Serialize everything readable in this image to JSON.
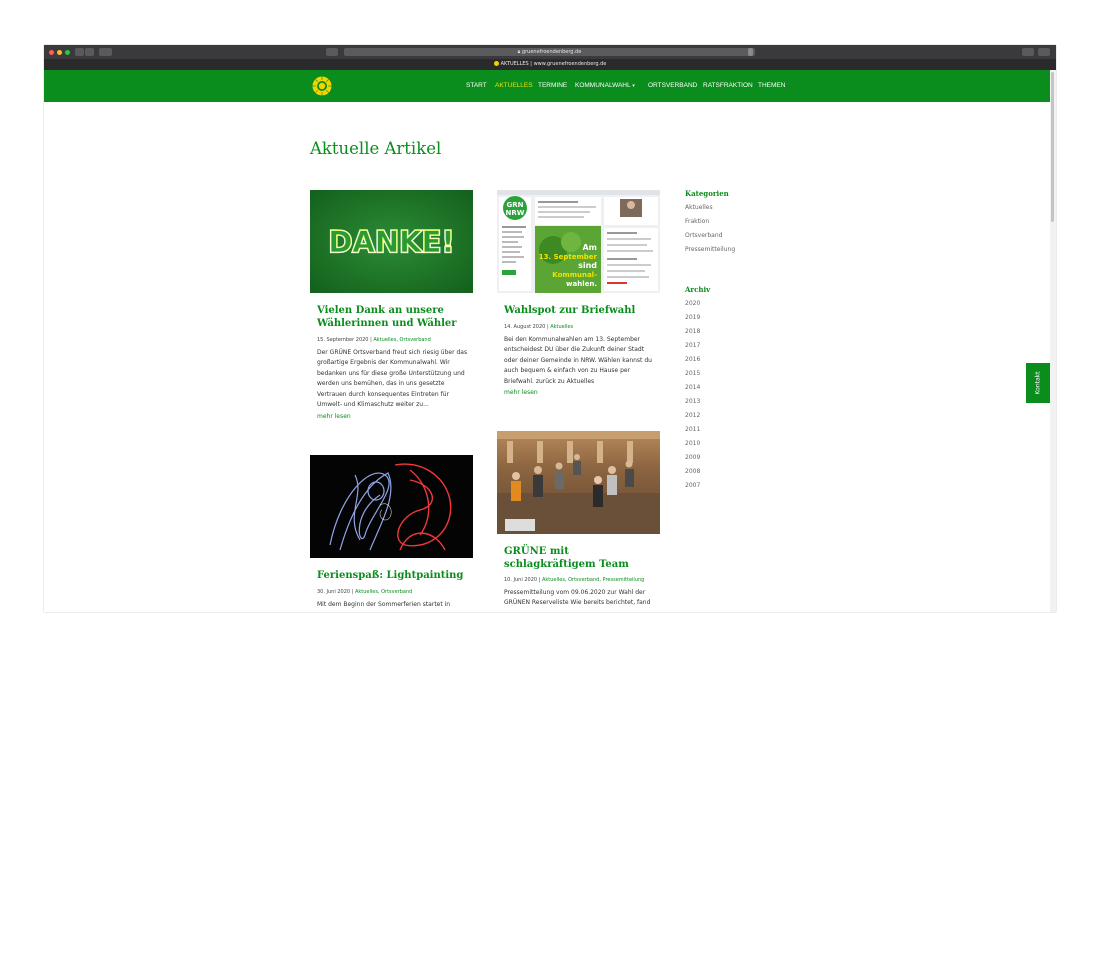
{
  "browser": {
    "url": "gruenefroendenberg.de",
    "tab_title": "AKTUELLES | www.gruenefroendenberg.de"
  },
  "nav": {
    "items": [
      "START",
      "AKTUELLES",
      "TERMINE",
      "KOMMUNALWAHL",
      "ORTSVERBAND",
      "RATSFRAKTION",
      "THEMEN"
    ],
    "active": "AKTUELLES",
    "dropdown_item": "KOMMUNALWAHL"
  },
  "page": {
    "title": "Aktuelle Artikel"
  },
  "posts": [
    {
      "title": "Vielen Dank an unsere Wählerinnen und Wähler",
      "image_text": "DANKE!",
      "date": "15. September 2020",
      "categories": [
        "Aktuelles",
        "Ortsverband"
      ],
      "excerpt": "Der GRÜNE Ortsverband freut sich riesig über das großartige Ergebnis der Kommunalwahl. Wir bedanken uns für diese große Unterstützung und werden uns bemühen, das in uns gesetzte Vertrauen durch konsequentes Eintreten für Umwelt- und Klimaschutz weiter zu...",
      "more": "mehr lesen"
    },
    {
      "title": "Wahlspot zur Briefwahl",
      "image_text": "Am 13. September sind Kommunal-wahlen.",
      "image_badge": "GRN NRW",
      "date": "14. August 2020",
      "categories": [
        "Aktuelles"
      ],
      "excerpt": "Bei den Kommunalwahlen am 13. September entscheidest DU über die Zukunft deiner Stadt oder deiner Gemeinde in NRW. Wählen kannst du auch bequem & einfach von zu Hause per Briefwahl.     zurück zu Aktuelles",
      "more": "mehr lesen"
    },
    {
      "title": "Ferienspaß: Lightpainting",
      "date": "30. Juni 2020",
      "categories": [
        "Aktuelles",
        "Ortsverband"
      ],
      "excerpt": "Mit dem Beginn der Sommerferien startet in"
    },
    {
      "title": "GRÜNE mit schlagkräftigem Team",
      "date": "10. Juni 2020",
      "categories": [
        "Aktuelles",
        "Ortsverband",
        "Pressemitteilung"
      ],
      "excerpt": "Pressemitteilung vom 09.06.2020 zur Wahl der GRÜNEN Reserveliste Wie bereits berichtet, fand"
    }
  ],
  "sidebar": {
    "categories_title": "Kategorien",
    "categories": [
      "Aktuelles",
      "Fraktion",
      "Ortsverband",
      "Pressemitteilung"
    ],
    "archive_title": "Archiv",
    "archive": [
      "2020",
      "2019",
      "2018",
      "2017",
      "2016",
      "2015",
      "2014",
      "2013",
      "2012",
      "2011",
      "2010",
      "2009",
      "2008",
      "2007"
    ]
  },
  "contact_tab": "Kontakt",
  "colors": {
    "brand_green": "#0a8d1c",
    "active_nav": "#f2e000",
    "text": "#333333"
  }
}
